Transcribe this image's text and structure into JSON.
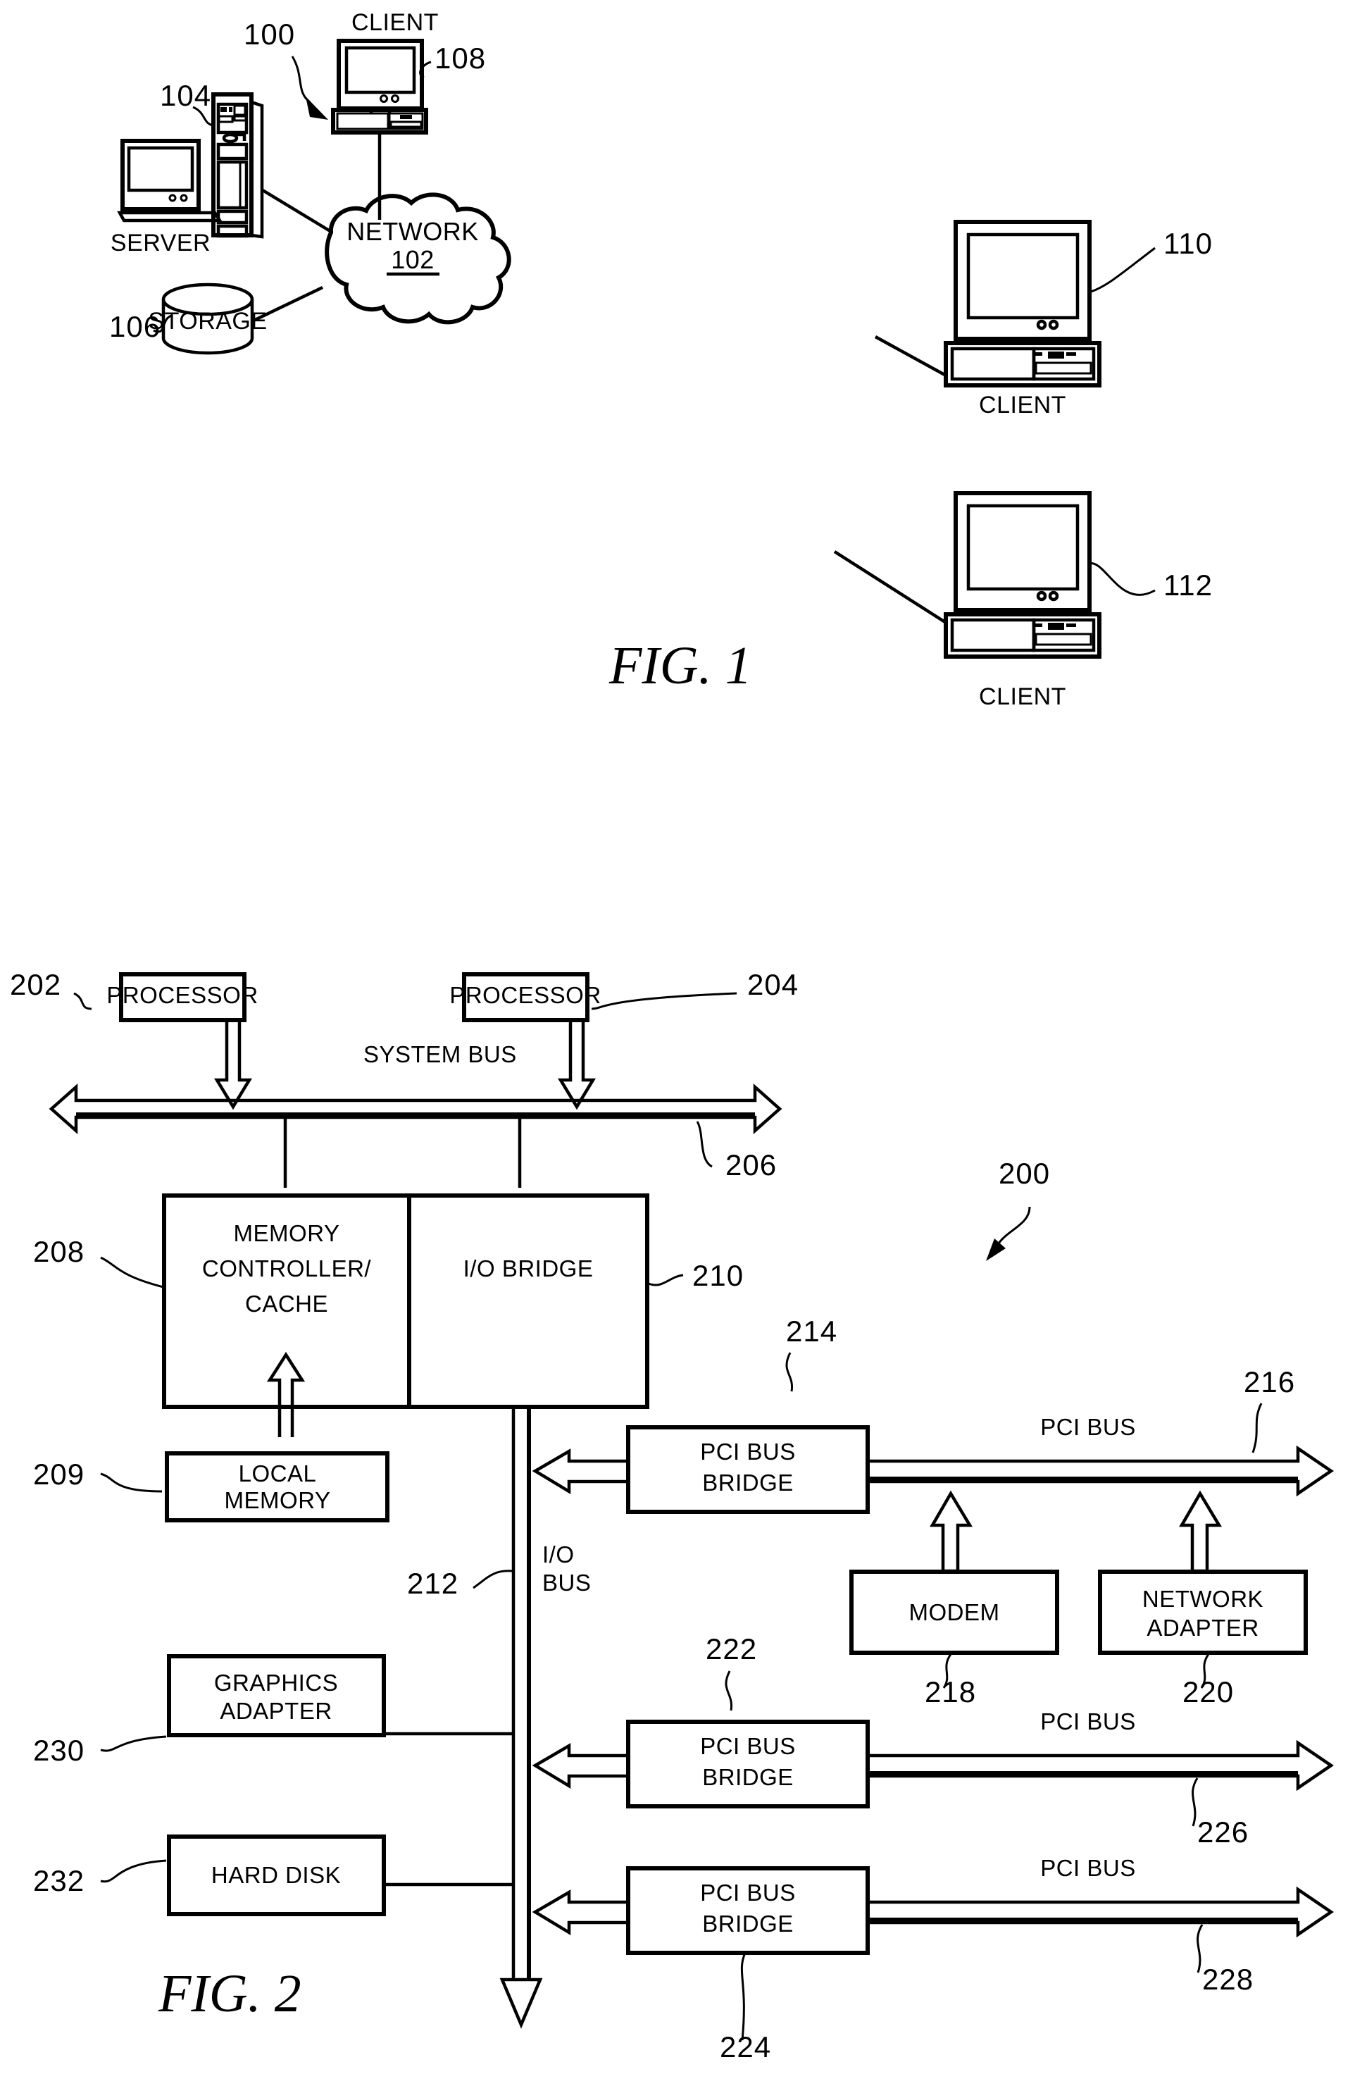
{
  "figure1": {
    "caption": "FIG.  1",
    "system_ref": "100",
    "nodes": {
      "server": {
        "label": "SERVER",
        "ref": "104"
      },
      "storage": {
        "label": "STORAGE",
        "ref": "106"
      },
      "network": {
        "label": "NETWORK",
        "ref": "102"
      },
      "client_top": {
        "label": "CLIENT",
        "ref": "108"
      },
      "client_mid": {
        "label": "CLIENT",
        "ref": "110"
      },
      "client_bottom": {
        "label": "CLIENT",
        "ref": "112"
      }
    }
  },
  "figure2": {
    "caption": "FIG.  2",
    "system_ref": "200",
    "blocks": {
      "processor1": {
        "label": "PROCESSOR",
        "ref": "202"
      },
      "processor2": {
        "label": "PROCESSOR",
        "ref": "204"
      },
      "memory_controller": {
        "line1": "MEMORY",
        "line2": "CONTROLLER/",
        "line3": "CACHE",
        "ref": "208"
      },
      "io_bridge": {
        "label": "I/O  BRIDGE",
        "ref": "210"
      },
      "local_memory": {
        "line1": "LOCAL",
        "line2": "MEMORY",
        "ref": "209"
      },
      "graphics_adapter": {
        "line1": "GRAPHICS",
        "line2": "ADAPTER",
        "ref": "230"
      },
      "hard_disk": {
        "label": "HARD  DISK",
        "ref": "232"
      },
      "pci_bridge_1": {
        "line1": "PCI BUS",
        "line2": "BRIDGE",
        "ref": "214"
      },
      "pci_bridge_2": {
        "line1": "PCI BUS",
        "line2": "BRIDGE",
        "ref": "222"
      },
      "pci_bridge_3": {
        "line1": "PCI BUS",
        "line2": "BRIDGE",
        "ref": "224"
      },
      "modem": {
        "label": "MODEM",
        "ref": "218"
      },
      "network_adapter": {
        "line1": "NETWORK",
        "line2": "ADAPTER",
        "ref": "220"
      }
    },
    "buses": {
      "system_bus": {
        "label": "SYSTEM  BUS",
        "ref": "206"
      },
      "io_bus": {
        "line1": "I/O",
        "line2": "BUS",
        "ref": "212"
      },
      "pci_bus_1": {
        "label": "PCI  BUS",
        "ref": "216"
      },
      "pci_bus_2": {
        "label": "PCI  BUS",
        "ref": "226"
      },
      "pci_bus_3": {
        "label": "PCI  BUS",
        "ref": "228"
      }
    }
  }
}
